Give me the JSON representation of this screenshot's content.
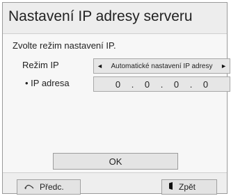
{
  "dialog": {
    "title": "Nastavení IP adresy serveru",
    "instruction": "Zvolte režim nastavení IP."
  },
  "mode_row": {
    "label": "Režim IP",
    "value": "Automatické nastavení IP adresy",
    "left_arrow": "◄",
    "right_arrow": "►"
  },
  "ip_row": {
    "label": "• IP adresa",
    "octets": [
      "0",
      "0",
      "0",
      "0"
    ],
    "separator": "."
  },
  "ok_button": {
    "label": "OK"
  },
  "footer": {
    "back_label": "Předc.",
    "back_icon": "remote-back-icon",
    "return_label": "Zpět",
    "return_icon": "exit-door-icon"
  }
}
